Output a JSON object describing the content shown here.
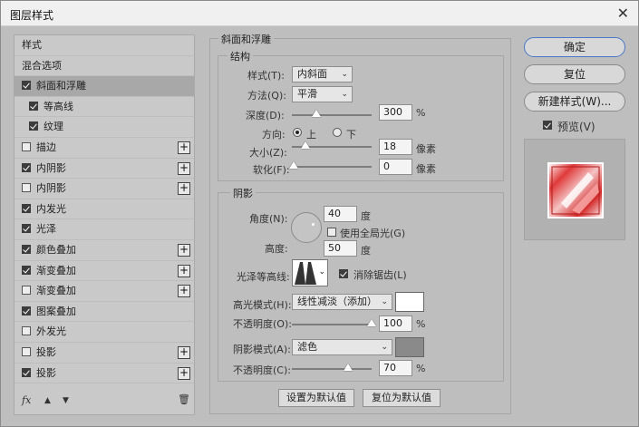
{
  "window": {
    "title": "图层样式",
    "close_glyph": "✕"
  },
  "left_panel": {
    "items": [
      {
        "label": "样式",
        "checkbox": false,
        "checked": false,
        "plus": false,
        "sub": false,
        "selected": false
      },
      {
        "label": "混合选项",
        "checkbox": false,
        "checked": false,
        "plus": false,
        "sub": false,
        "selected": false
      },
      {
        "label": "斜面和浮雕",
        "checkbox": true,
        "checked": true,
        "plus": false,
        "sub": false,
        "selected": true
      },
      {
        "label": "等高线",
        "checkbox": true,
        "checked": true,
        "plus": false,
        "sub": true,
        "selected": false
      },
      {
        "label": "纹理",
        "checkbox": true,
        "checked": true,
        "plus": false,
        "sub": true,
        "selected": false
      },
      {
        "label": "描边",
        "checkbox": true,
        "checked": false,
        "plus": true,
        "sub": false,
        "selected": false
      },
      {
        "label": "内阴影",
        "checkbox": true,
        "checked": true,
        "plus": true,
        "sub": false,
        "selected": false
      },
      {
        "label": "内阴影",
        "checkbox": true,
        "checked": false,
        "plus": true,
        "sub": false,
        "selected": false
      },
      {
        "label": "内发光",
        "checkbox": true,
        "checked": true,
        "plus": false,
        "sub": false,
        "selected": false
      },
      {
        "label": "光泽",
        "checkbox": true,
        "checked": true,
        "plus": false,
        "sub": false,
        "selected": false
      },
      {
        "label": "颜色叠加",
        "checkbox": true,
        "checked": true,
        "plus": true,
        "sub": false,
        "selected": false
      },
      {
        "label": "渐变叠加",
        "checkbox": true,
        "checked": true,
        "plus": true,
        "sub": false,
        "selected": false
      },
      {
        "label": "渐变叠加",
        "checkbox": true,
        "checked": false,
        "plus": true,
        "sub": false,
        "selected": false
      },
      {
        "label": "图案叠加",
        "checkbox": true,
        "checked": true,
        "plus": false,
        "sub": false,
        "selected": false
      },
      {
        "label": "外发光",
        "checkbox": true,
        "checked": false,
        "plus": false,
        "sub": false,
        "selected": false
      },
      {
        "label": "投影",
        "checkbox": true,
        "checked": false,
        "plus": true,
        "sub": false,
        "selected": false
      },
      {
        "label": "投影",
        "checkbox": true,
        "checked": true,
        "plus": true,
        "sub": false,
        "selected": false
      }
    ],
    "footer": {
      "fx": "fx",
      "up_icon": "▲",
      "down_icon": "▼",
      "trash_icon": "🗑"
    }
  },
  "bevel": {
    "group_title": "斜面和浮雕",
    "structure": {
      "title": "结构",
      "style_label": "样式(T):",
      "style_value": "内斜面",
      "method_label": "方法(Q):",
      "method_value": "平滑",
      "depth_label": "深度(D):",
      "depth_value": "300",
      "depth_unit": "%",
      "depth_level": 0.3,
      "direction_label": "方向:",
      "direction_up": "上",
      "direction_down": "下",
      "size_label": "大小(Z):",
      "size_value": "18",
      "size_unit": "像素",
      "size_level": 0.12,
      "soften_label": "软化(F):",
      "soften_value": "0",
      "soften_unit": "像素",
      "soften_level": 0.0
    },
    "shading": {
      "title": "阴影",
      "angle_label": "角度(N):",
      "angle_value": "40",
      "angle_unit": "度",
      "global_light_label": "使用全局光(G)",
      "global_light_checked": false,
      "altitude_label": "高度:",
      "altitude_value": "50",
      "altitude_unit": "度",
      "gloss_label": "光泽等高线:",
      "antialias_label": "消除锯齿(L)",
      "antialias_checked": true,
      "highlight_label": "高光模式(H):",
      "highlight_value": "线性减淡（添加）",
      "highlight_color": "#ffffff",
      "opacity1_label": "不透明度(O):",
      "opacity1_value": "100",
      "opacity1_unit": "%",
      "opacity1_level": 1.0,
      "shadow_label": "阴影模式(A):",
      "shadow_value": "滤色",
      "shadow_color": "#8a8a8a",
      "opacity2_label": "不透明度(C):",
      "opacity2_value": "70",
      "opacity2_unit": "%",
      "opacity2_level": 0.7
    },
    "make_default": "设置为默认值",
    "reset_default": "复位为默认值"
  },
  "right": {
    "ok": "确定",
    "reset": "复位",
    "new_style": "新建样式(W)...",
    "preview_label": "预览(V)",
    "preview_checked": true
  },
  "colors": {
    "accent": "#4a78c7",
    "selected_row": "#a8a8a8",
    "preview_red": "#e03a3a"
  }
}
